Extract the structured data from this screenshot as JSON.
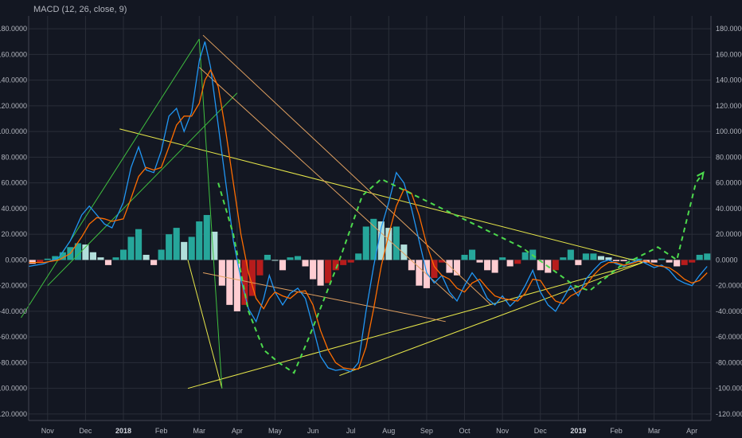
{
  "indicator_label": "MACD (12, 26, close, 9)",
  "colors": {
    "background": "#131722",
    "grid": "#2a2e39",
    "macd_line": "#2196f3",
    "signal_line": "#ff6d00",
    "hist_pos_strong": "#26a69a",
    "hist_pos_weak": "#b2dfdb",
    "hist_neg_strong": "#b71c1c",
    "hist_neg_weak": "#ffcdd2",
    "trend_yellow": "#e8e84a",
    "trend_green": "#3fbf3f",
    "trend_orange": "#e0a060",
    "forecast_dash": "#4cd94c"
  },
  "chart_data": {
    "type": "line",
    "y_ticks": [
      "180.0000",
      "160.0000",
      "140.0000",
      "120.0000",
      "100.0000",
      "80.0000",
      "60.0000",
      "40.0000",
      "20.0000",
      "0.0000",
      "-20.0000",
      "-40.0000",
      "-60.0000",
      "-80.0000",
      "-100.0000",
      "-120.0000"
    ],
    "ylim": [
      -125,
      190
    ],
    "x_ticks": [
      {
        "label": "Nov",
        "bold": false
      },
      {
        "label": "Dec",
        "bold": false
      },
      {
        "label": "2018",
        "bold": true
      },
      {
        "label": "Feb",
        "bold": false
      },
      {
        "label": "Mar",
        "bold": false
      },
      {
        "label": "Apr",
        "bold": false
      },
      {
        "label": "May",
        "bold": false
      },
      {
        "label": "Jun",
        "bold": false
      },
      {
        "label": "Jul",
        "bold": false
      },
      {
        "label": "Aug",
        "bold": false
      },
      {
        "label": "Sep",
        "bold": false
      },
      {
        "label": "Oct",
        "bold": false
      },
      {
        "label": "Nov",
        "bold": false
      },
      {
        "label": "Dec",
        "bold": false
      },
      {
        "label": "2019",
        "bold": true
      },
      {
        "label": "Feb",
        "bold": false
      },
      {
        "label": "Mar",
        "bold": false
      },
      {
        "label": "Apr",
        "bold": false
      }
    ],
    "xlim": [
      0,
      18
    ],
    "series": [
      {
        "key": "macd",
        "values": [
          [
            0,
            -5
          ],
          [
            0.4,
            -3
          ],
          [
            0.8,
            2
          ],
          [
            1.1,
            15
          ],
          [
            1.4,
            35
          ],
          [
            1.6,
            42
          ],
          [
            1.8,
            35
          ],
          [
            2.0,
            28
          ],
          [
            2.2,
            25
          ],
          [
            2.5,
            45
          ],
          [
            2.7,
            72
          ],
          [
            2.9,
            88
          ],
          [
            3.1,
            70
          ],
          [
            3.3,
            68
          ],
          [
            3.5,
            85
          ],
          [
            3.7,
            112
          ],
          [
            3.9,
            118
          ],
          [
            4.1,
            100
          ],
          [
            4.3,
            115
          ],
          [
            4.5,
            155
          ],
          [
            4.65,
            170
          ],
          [
            4.8,
            150
          ],
          [
            5.0,
            105
          ],
          [
            5.2,
            60
          ],
          [
            5.4,
            15
          ],
          [
            5.6,
            -15
          ],
          [
            5.8,
            -38
          ],
          [
            6.0,
            -48
          ],
          [
            6.2,
            -30
          ],
          [
            6.35,
            -12
          ],
          [
            6.5,
            -25
          ],
          [
            6.7,
            -35
          ],
          [
            6.9,
            -26
          ],
          [
            7.1,
            -22
          ],
          [
            7.3,
            -30
          ],
          [
            7.5,
            -52
          ],
          [
            7.7,
            -75
          ],
          [
            7.9,
            -84
          ],
          [
            8.1,
            -86
          ],
          [
            8.3,
            -85
          ],
          [
            8.5,
            -87
          ],
          [
            8.7,
            -80
          ],
          [
            8.9,
            -40
          ],
          [
            9.1,
            -5
          ],
          [
            9.3,
            25
          ],
          [
            9.5,
            45
          ],
          [
            9.7,
            68
          ],
          [
            9.9,
            60
          ],
          [
            10.1,
            40
          ],
          [
            10.3,
            15
          ],
          [
            10.5,
            -10
          ],
          [
            10.7,
            -18
          ],
          [
            10.9,
            -12
          ],
          [
            11.1,
            -25
          ],
          [
            11.3,
            -32
          ],
          [
            11.5,
            -20
          ],
          [
            11.7,
            -10
          ],
          [
            11.9,
            -18
          ],
          [
            12.1,
            -30
          ],
          [
            12.3,
            -35
          ],
          [
            12.5,
            -28
          ],
          [
            12.7,
            -36
          ],
          [
            12.9,
            -30
          ],
          [
            13.1,
            -20
          ],
          [
            13.3,
            -8
          ],
          [
            13.5,
            -25
          ],
          [
            13.7,
            -35
          ],
          [
            13.9,
            -40
          ],
          [
            14.1,
            -30
          ],
          [
            14.3,
            -20
          ],
          [
            14.5,
            -28
          ],
          [
            14.7,
            -15
          ],
          [
            14.9,
            -8
          ],
          [
            15.1,
            -2
          ],
          [
            15.3,
            0
          ],
          [
            15.5,
            -3
          ],
          [
            15.7,
            -5
          ],
          [
            15.9,
            -2
          ],
          [
            16.1,
            0
          ],
          [
            16.3,
            -3
          ],
          [
            16.5,
            -6
          ],
          [
            16.7,
            -4
          ],
          [
            16.9,
            -8
          ],
          [
            17.1,
            -15
          ],
          [
            17.3,
            -18
          ],
          [
            17.5,
            -20
          ],
          [
            17.7,
            -12
          ],
          [
            17.9,
            -5
          ],
          [
            18.1,
            0
          ],
          [
            18.3,
            5
          ],
          [
            18.5,
            8
          ],
          [
            18.7,
            5
          ],
          [
            18.9,
            0
          ],
          [
            19.1,
            -4
          ]
        ]
      },
      {
        "key": "signal",
        "values": [
          [
            0,
            -2
          ],
          [
            0.4,
            -2
          ],
          [
            0.8,
            0
          ],
          [
            1.1,
            5
          ],
          [
            1.4,
            18
          ],
          [
            1.6,
            28
          ],
          [
            1.8,
            33
          ],
          [
            2.0,
            32
          ],
          [
            2.2,
            30
          ],
          [
            2.5,
            32
          ],
          [
            2.7,
            48
          ],
          [
            2.9,
            65
          ],
          [
            3.1,
            72
          ],
          [
            3.3,
            70
          ],
          [
            3.5,
            72
          ],
          [
            3.7,
            88
          ],
          [
            3.9,
            105
          ],
          [
            4.1,
            112
          ],
          [
            4.3,
            112
          ],
          [
            4.5,
            122
          ],
          [
            4.65,
            140
          ],
          [
            4.8,
            148
          ],
          [
            5.0,
            135
          ],
          [
            5.2,
            100
          ],
          [
            5.4,
            60
          ],
          [
            5.6,
            20
          ],
          [
            5.8,
            -10
          ],
          [
            6.0,
            -30
          ],
          [
            6.2,
            -38
          ],
          [
            6.35,
            -30
          ],
          [
            6.5,
            -25
          ],
          [
            6.7,
            -28
          ],
          [
            6.9,
            -30
          ],
          [
            7.1,
            -25
          ],
          [
            7.3,
            -24
          ],
          [
            7.5,
            -35
          ],
          [
            7.7,
            -55
          ],
          [
            7.9,
            -70
          ],
          [
            8.1,
            -80
          ],
          [
            8.3,
            -84
          ],
          [
            8.5,
            -85
          ],
          [
            8.7,
            -85
          ],
          [
            8.9,
            -68
          ],
          [
            9.1,
            -38
          ],
          [
            9.3,
            -5
          ],
          [
            9.5,
            20
          ],
          [
            9.7,
            42
          ],
          [
            9.9,
            55
          ],
          [
            10.1,
            52
          ],
          [
            10.3,
            35
          ],
          [
            10.5,
            12
          ],
          [
            10.7,
            -5
          ],
          [
            10.9,
            -12
          ],
          [
            11.1,
            -15
          ],
          [
            11.3,
            -22
          ],
          [
            11.5,
            -25
          ],
          [
            11.7,
            -18
          ],
          [
            11.9,
            -15
          ],
          [
            12.1,
            -22
          ],
          [
            12.3,
            -28
          ],
          [
            12.5,
            -30
          ],
          [
            12.7,
            -31
          ],
          [
            12.9,
            -32
          ],
          [
            13.1,
            -26
          ],
          [
            13.3,
            -15
          ],
          [
            13.5,
            -16
          ],
          [
            13.7,
            -25
          ],
          [
            13.9,
            -32
          ],
          [
            14.1,
            -34
          ],
          [
            14.3,
            -28
          ],
          [
            14.5,
            -25
          ],
          [
            14.7,
            -20
          ],
          [
            14.9,
            -12
          ],
          [
            15.1,
            -6
          ],
          [
            15.3,
            -2
          ],
          [
            15.5,
            -2
          ],
          [
            15.7,
            -4
          ],
          [
            15.9,
            -3
          ],
          [
            16.1,
            -1
          ],
          [
            16.3,
            -1
          ],
          [
            16.5,
            -4
          ],
          [
            16.7,
            -5
          ],
          [
            16.9,
            -6
          ],
          [
            17.1,
            -10
          ],
          [
            17.3,
            -15
          ],
          [
            17.5,
            -18
          ],
          [
            17.7,
            -16
          ],
          [
            17.9,
            -10
          ],
          [
            18.1,
            -4
          ],
          [
            18.3,
            2
          ],
          [
            18.5,
            6
          ],
          [
            18.7,
            6
          ],
          [
            18.9,
            3
          ],
          [
            19.1,
            -1
          ]
        ]
      }
    ],
    "histogram": [
      [
        0.1,
        -3
      ],
      [
        0.3,
        -2
      ],
      [
        0.5,
        1
      ],
      [
        0.7,
        3
      ],
      [
        0.9,
        6
      ],
      [
        1.1,
        10
      ],
      [
        1.3,
        13
      ],
      [
        1.5,
        12
      ],
      [
        1.7,
        6
      ],
      [
        1.9,
        2
      ],
      [
        2.1,
        -4
      ],
      [
        2.3,
        2
      ],
      [
        2.5,
        8
      ],
      [
        2.7,
        18
      ],
      [
        2.9,
        24
      ],
      [
        3.1,
        4
      ],
      [
        3.3,
        -4
      ],
      [
        3.5,
        8
      ],
      [
        3.7,
        20
      ],
      [
        3.9,
        25
      ],
      [
        4.1,
        14
      ],
      [
        4.3,
        18
      ],
      [
        4.5,
        30
      ],
      [
        4.7,
        35
      ],
      [
        4.9,
        22
      ],
      [
        5.1,
        -20
      ],
      [
        5.3,
        -35
      ],
      [
        5.5,
        -40
      ],
      [
        5.7,
        -35
      ],
      [
        5.9,
        -28
      ],
      [
        6.1,
        -12
      ],
      [
        6.3,
        4
      ],
      [
        6.5,
        0
      ],
      [
        6.7,
        -8
      ],
      [
        6.9,
        2
      ],
      [
        7.1,
        3
      ],
      [
        7.3,
        -5
      ],
      [
        7.5,
        -15
      ],
      [
        7.7,
        -20
      ],
      [
        7.9,
        -18
      ],
      [
        8.1,
        -8
      ],
      [
        8.3,
        -4
      ],
      [
        8.5,
        -2
      ],
      [
        8.7,
        5
      ],
      [
        8.9,
        26
      ],
      [
        9.1,
        32
      ],
      [
        9.3,
        30
      ],
      [
        9.5,
        25
      ],
      [
        9.7,
        26
      ],
      [
        9.9,
        12
      ],
      [
        10.1,
        -8
      ],
      [
        10.3,
        -20
      ],
      [
        10.5,
        -22
      ],
      [
        10.7,
        -14
      ],
      [
        10.9,
        -2
      ],
      [
        11.1,
        -10
      ],
      [
        11.3,
        -12
      ],
      [
        11.5,
        4
      ],
      [
        11.7,
        8
      ],
      [
        11.9,
        -2
      ],
      [
        12.1,
        -8
      ],
      [
        12.3,
        -10
      ],
      [
        12.5,
        2
      ],
      [
        12.7,
        -5
      ],
      [
        12.9,
        -3
      ],
      [
        13.1,
        6
      ],
      [
        13.3,
        8
      ],
      [
        13.5,
        -8
      ],
      [
        13.7,
        -10
      ],
      [
        13.9,
        -8
      ],
      [
        14.1,
        2
      ],
      [
        14.3,
        8
      ],
      [
        14.5,
        -4
      ],
      [
        14.7,
        5
      ],
      [
        14.9,
        5
      ],
      [
        15.1,
        3
      ],
      [
        15.3,
        2
      ],
      [
        15.5,
        -1
      ],
      [
        15.7,
        -1
      ],
      [
        15.9,
        1
      ],
      [
        16.1,
        1
      ],
      [
        16.3,
        -2
      ],
      [
        16.5,
        -2
      ],
      [
        16.7,
        1
      ],
      [
        16.9,
        -2
      ],
      [
        17.1,
        -5
      ],
      [
        17.3,
        -4
      ],
      [
        17.5,
        -2
      ],
      [
        17.7,
        4
      ],
      [
        17.9,
        5
      ],
      [
        18.1,
        4
      ],
      [
        18.3,
        3
      ],
      [
        18.5,
        2
      ],
      [
        18.7,
        -1
      ],
      [
        18.9,
        -3
      ],
      [
        19.1,
        -3
      ]
    ],
    "trend_lines": [
      {
        "color": "trend_yellow",
        "points": [
          [
            2.4,
            102
          ],
          [
            16.2,
            -2
          ]
        ]
      },
      {
        "color": "trend_yellow",
        "points": [
          [
            4.2,
            0
          ],
          [
            5.1,
            -100
          ]
        ]
      },
      {
        "color": "trend_yellow",
        "points": [
          [
            4.2,
            -100
          ],
          [
            16.2,
            -2
          ]
        ]
      },
      {
        "color": "trend_yellow",
        "points": [
          [
            8.2,
            -90
          ],
          [
            16.2,
            -2
          ]
        ]
      },
      {
        "color": "trend_green",
        "points": [
          [
            -0.2,
            -45
          ],
          [
            4.5,
            172
          ]
        ]
      },
      {
        "color": "trend_green",
        "points": [
          [
            0.5,
            -20
          ],
          [
            5.5,
            130
          ]
        ]
      },
      {
        "color": "trend_green",
        "points": [
          [
            4.5,
            172
          ],
          [
            5.1,
            -100
          ]
        ]
      },
      {
        "color": "trend_orange",
        "points": [
          [
            4.6,
            175
          ],
          [
            12.2,
            -35
          ]
        ]
      },
      {
        "color": "trend_orange",
        "points": [
          [
            4.5,
            150
          ],
          [
            11.2,
            -30
          ]
        ]
      },
      {
        "color": "trend_orange",
        "points": [
          [
            4.6,
            -10
          ],
          [
            11.0,
            -48
          ]
        ]
      }
    ],
    "forecast": [
      [
        5.0,
        60
      ],
      [
        5.4,
        20
      ],
      [
        5.8,
        -40
      ],
      [
        6.2,
        -70
      ],
      [
        6.6,
        -80
      ],
      [
        7.0,
        -88
      ],
      [
        7.4,
        -60
      ],
      [
        7.8,
        -30
      ],
      [
        8.2,
        0
      ],
      [
        8.8,
        50
      ],
      [
        9.3,
        63
      ],
      [
        13.0,
        10
      ],
      [
        14.4,
        -20
      ],
      [
        14.8,
        -24
      ],
      [
        15.6,
        -5
      ],
      [
        16.6,
        10
      ],
      [
        17.1,
        0
      ],
      [
        17.6,
        60
      ],
      [
        17.8,
        68
      ]
    ]
  }
}
